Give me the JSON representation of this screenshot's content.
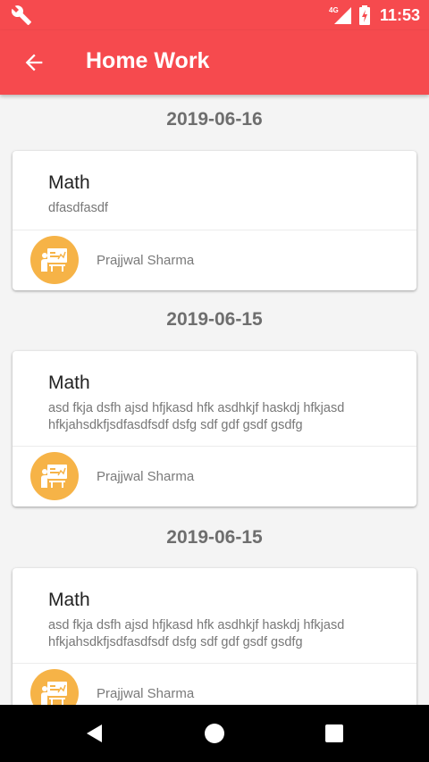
{
  "status_bar": {
    "time": "11:53",
    "network_label": "4G",
    "icons": [
      "wrench-icon",
      "signal-icon",
      "battery-charging-icon"
    ]
  },
  "app_bar": {
    "title": "Home Work",
    "back_icon": "arrow-left-icon"
  },
  "colors": {
    "primary": "#f64a4e",
    "avatar_bg": "#f6b347",
    "background": "#f4f4f4"
  },
  "sections": [
    {
      "date": "2019-06-16",
      "homework": {
        "subject": "Math",
        "description": "dfasdfasdf",
        "teacher": "Prajjwal Sharma",
        "teacher_icon": "teacher-board-icon"
      }
    },
    {
      "date": "2019-06-15",
      "homework": {
        "subject": "Math",
        "description": "asd fkja dsfh ajsd hfjkasd hfk asdhkjf haskdj hfkjasd hfkjahsdkfjsdfasdfsdf dsfg sdf gdf gsdf gsdfg",
        "teacher": "Prajjwal Sharma",
        "teacher_icon": "teacher-board-icon"
      }
    },
    {
      "date": "2019-06-15",
      "homework": {
        "subject": "Math",
        "description": "asd fkja dsfh ajsd hfjkasd hfk asdhkjf haskdj hfkjasd hfkjahsdkfjsdfasdfsdf dsfg sdf gdf gsdf gsdfg",
        "teacher": "Prajjwal Sharma",
        "teacher_icon": "teacher-board-icon"
      }
    }
  ],
  "nav_bar": {
    "buttons": [
      "back-triangle-icon",
      "home-circle-icon",
      "recents-square-icon"
    ]
  }
}
